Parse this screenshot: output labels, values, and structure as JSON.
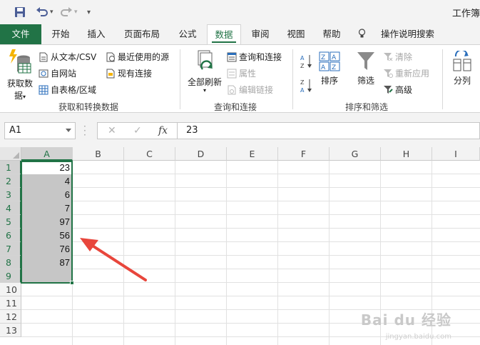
{
  "window": {
    "title": "工作簿"
  },
  "qat": {
    "save_icon": "save-icon",
    "undo_icon": "undo-icon",
    "redo_icon": "redo-icon",
    "customize_icon": "customize-qat-icon"
  },
  "tabs": [
    {
      "label": "文件"
    },
    {
      "label": "开始"
    },
    {
      "label": "插入"
    },
    {
      "label": "页面布局"
    },
    {
      "label": "公式"
    },
    {
      "label": "数据"
    },
    {
      "label": "审阅"
    },
    {
      "label": "视图"
    },
    {
      "label": "帮助"
    }
  ],
  "tell_me": {
    "label": "操作说明搜索"
  },
  "ribbon": {
    "get_data": {
      "label_line1": "获取数",
      "label_line2": "据"
    },
    "from_text": "从文本/CSV",
    "from_web": "自网站",
    "from_table": "自表格/区域",
    "recent_sources": "最近使用的源",
    "existing_connections": "现有连接",
    "group1": "获取和转换数据",
    "refresh_all": "全部刷新",
    "queries_connections": "查询和连接",
    "properties": "属性",
    "edit_links": "编辑链接",
    "group2": "查询和连接",
    "sort_az": "A↓Z",
    "sort_za": "Z↓A",
    "sort": "排序",
    "filter": "筛选",
    "clear": "清除",
    "reapply": "重新应用",
    "advanced": "高级",
    "group3": "排序和筛选",
    "text_to_columns": "分列"
  },
  "formula_bar": {
    "name_box": "A1",
    "cancel": "✕",
    "enter": "✓",
    "fx": "fx",
    "value": "23"
  },
  "grid": {
    "columns": [
      "A",
      "B",
      "C",
      "D",
      "E",
      "F",
      "G",
      "H",
      "I"
    ],
    "rows": [
      "1",
      "2",
      "3",
      "4",
      "5",
      "6",
      "7",
      "8",
      "9",
      "10",
      "11",
      "12",
      "13"
    ],
    "column_a_values": [
      "23",
      "4",
      "6",
      "7",
      "97",
      "56",
      "76",
      "87",
      ""
    ]
  },
  "watermark": {
    "text": "Bai du 经验",
    "sub": "jingyan.baidu.com"
  },
  "colors": {
    "accent": "#217346",
    "arrow": "#e8463c"
  }
}
